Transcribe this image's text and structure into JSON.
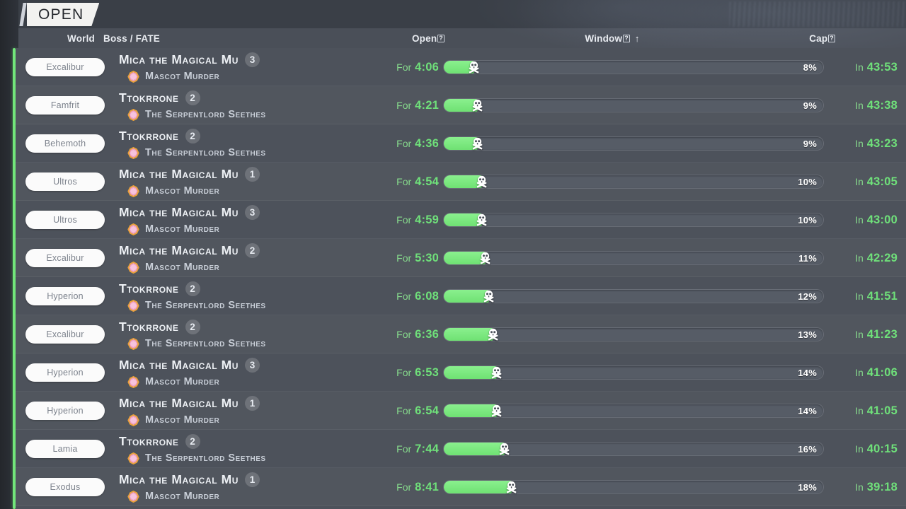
{
  "tab": {
    "label": "OPEN"
  },
  "columns": {
    "world": "World",
    "boss": "Boss / FATE",
    "open": "Open",
    "open_sup": "?",
    "window": "Window",
    "window_sup": "?",
    "window_sort": "↑",
    "cap": "Cap",
    "cap_sup": "?"
  },
  "labels": {
    "for": "For",
    "in": "In"
  },
  "icons": {
    "fate": "fate-gem-icon",
    "skull": "skull-crossbones-icon",
    "sort": "sort-ascending-icon"
  },
  "colors": {
    "accent_green": "#72e67a",
    "bar_fill": "#7ae87f",
    "pill_bg": "#fbfbfb",
    "row_bg": "#4d525b",
    "tab_bg": "#f2f2f0"
  },
  "rows": [
    {
      "world": "Excalibur",
      "boss": "Mica the Magical Mu",
      "rank": "3",
      "fate": "Mascot Murder",
      "open": "4:06",
      "percent": "8%",
      "pct_num": 8,
      "cap": "43:53"
    },
    {
      "world": "Famfrit",
      "boss": "Ttokrrone",
      "rank": "2",
      "fate": "The Serpentlord Seethes",
      "open": "4:21",
      "percent": "9%",
      "pct_num": 9,
      "cap": "43:38"
    },
    {
      "world": "Behemoth",
      "boss": "Ttokrrone",
      "rank": "2",
      "fate": "The Serpentlord Seethes",
      "open": "4:36",
      "percent": "9%",
      "pct_num": 9,
      "cap": "43:23"
    },
    {
      "world": "Ultros",
      "boss": "Mica the Magical Mu",
      "rank": "1",
      "fate": "Mascot Murder",
      "open": "4:54",
      "percent": "10%",
      "pct_num": 10,
      "cap": "43:05"
    },
    {
      "world": "Ultros",
      "boss": "Mica the Magical Mu",
      "rank": "3",
      "fate": "Mascot Murder",
      "open": "4:59",
      "percent": "10%",
      "pct_num": 10,
      "cap": "43:00"
    },
    {
      "world": "Excalibur",
      "boss": "Mica the Magical Mu",
      "rank": "2",
      "fate": "Mascot Murder",
      "open": "5:30",
      "percent": "11%",
      "pct_num": 11,
      "cap": "42:29"
    },
    {
      "world": "Hyperion",
      "boss": "Ttokrrone",
      "rank": "2",
      "fate": "The Serpentlord Seethes",
      "open": "6:08",
      "percent": "12%",
      "pct_num": 12,
      "cap": "41:51"
    },
    {
      "world": "Excalibur",
      "boss": "Ttokrrone",
      "rank": "2",
      "fate": "The Serpentlord Seethes",
      "open": "6:36",
      "percent": "13%",
      "pct_num": 13,
      "cap": "41:23"
    },
    {
      "world": "Hyperion",
      "boss": "Mica the Magical Mu",
      "rank": "3",
      "fate": "Mascot Murder",
      "open": "6:53",
      "percent": "14%",
      "pct_num": 14,
      "cap": "41:06"
    },
    {
      "world": "Hyperion",
      "boss": "Mica the Magical Mu",
      "rank": "1",
      "fate": "Mascot Murder",
      "open": "6:54",
      "percent": "14%",
      "pct_num": 14,
      "cap": "41:05"
    },
    {
      "world": "Lamia",
      "boss": "Ttokrrone",
      "rank": "2",
      "fate": "The Serpentlord Seethes",
      "open": "7:44",
      "percent": "16%",
      "pct_num": 16,
      "cap": "40:15"
    },
    {
      "world": "Exodus",
      "boss": "Mica the Magical Mu",
      "rank": "1",
      "fate": "Mascot Murder",
      "open": "8:41",
      "percent": "18%",
      "pct_num": 18,
      "cap": "39:18"
    }
  ]
}
